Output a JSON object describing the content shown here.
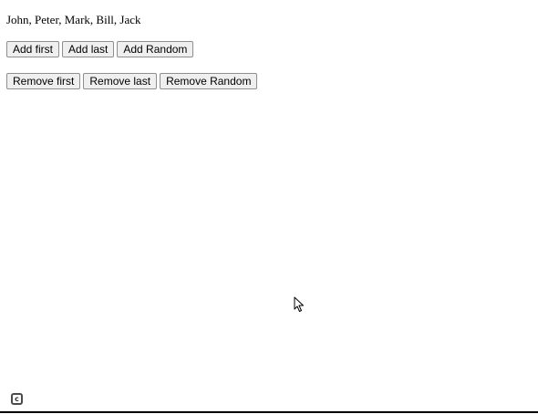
{
  "names_text": "John, Peter, Mark, Bill, Jack",
  "add_buttons": {
    "add_first": "Add first",
    "add_last": "Add last",
    "add_random": "Add Random"
  },
  "remove_buttons": {
    "remove_first": "Remove first",
    "remove_last": "Remove last",
    "remove_random": "Remove Random"
  },
  "icons": {
    "cursor": "mouse-pointer-icon",
    "corner": "recorder-logo-icon"
  },
  "colors": {
    "button_bg": "#efefef",
    "button_border": "#8f8f8f",
    "text": "#000000"
  }
}
